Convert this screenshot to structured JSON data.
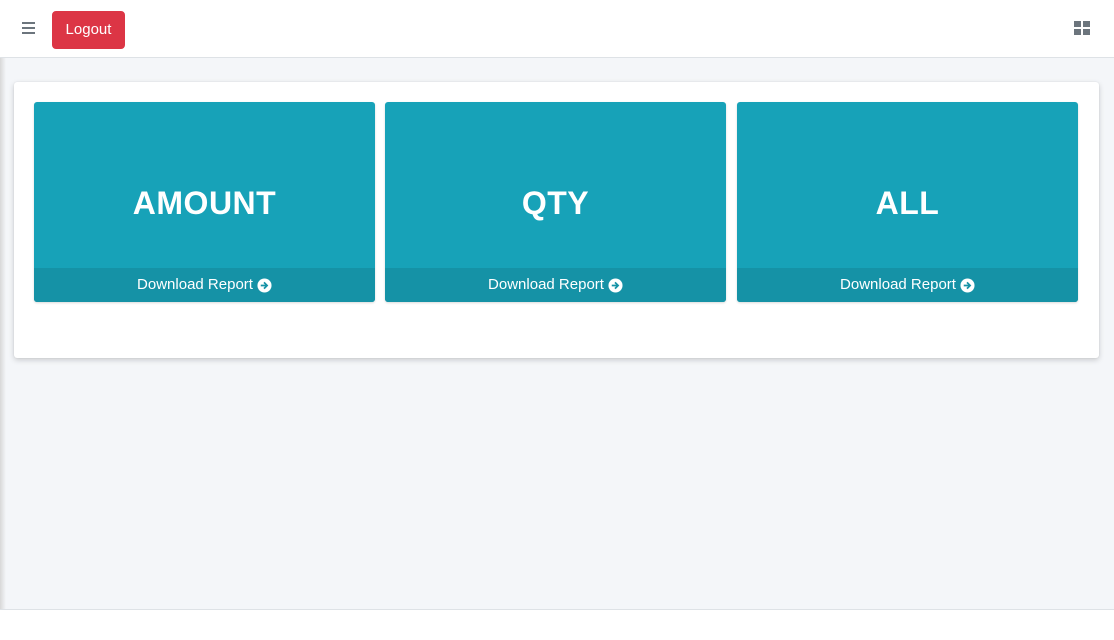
{
  "navbar": {
    "menu_icon": "bars-icon",
    "logout_label": "Logout",
    "apps_icon": "th-large-icon"
  },
  "colors": {
    "box_bg": "#17a2b8",
    "box_footer_bg": "#1592a6",
    "logout_bg": "#dc3545"
  },
  "reports": [
    {
      "title": "AMOUNT",
      "link_label": "Download Report",
      "link_icon": "arrow-circle-right-icon"
    },
    {
      "title": "QTY",
      "link_label": "Download Report",
      "link_icon": "arrow-circle-right-icon"
    },
    {
      "title": "ALL",
      "link_label": "Download Report",
      "link_icon": "arrow-circle-right-icon"
    }
  ]
}
